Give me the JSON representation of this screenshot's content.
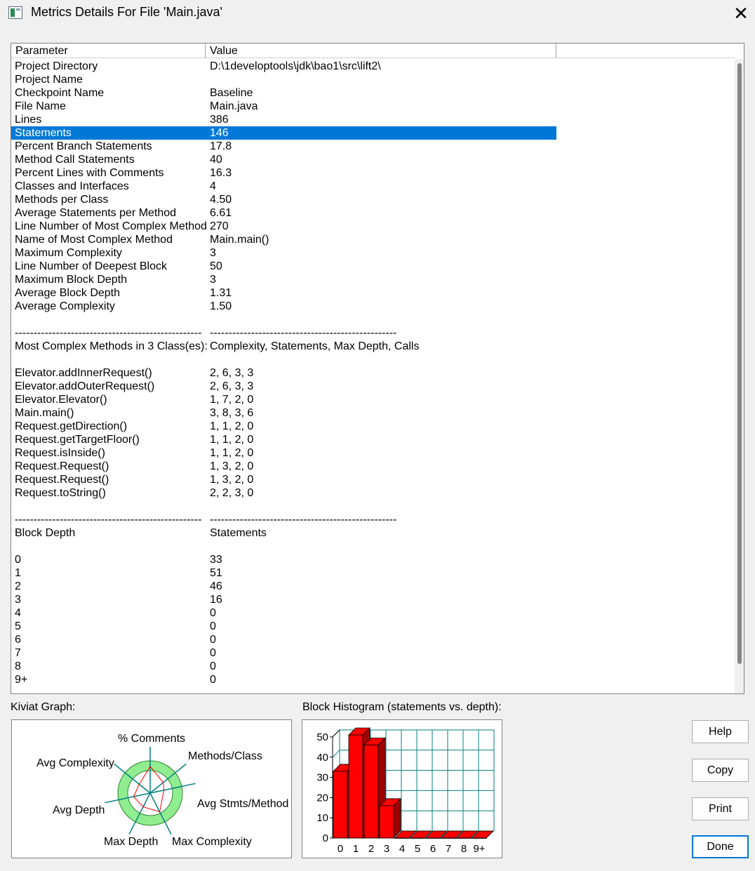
{
  "window": {
    "title": "Metrics Details For File 'Main.java'",
    "close_glyph": "✕"
  },
  "list": {
    "headers": {
      "parameter": "Parameter",
      "value": "Value"
    },
    "rows": [
      {
        "p": "Project Directory",
        "v": "D:\\1developtools\\jdk\\bao1\\src\\lift2\\"
      },
      {
        "p": "Project Name",
        "v": ""
      },
      {
        "p": "Checkpoint Name",
        "v": "Baseline"
      },
      {
        "p": "File Name",
        "v": "Main.java"
      },
      {
        "p": "Lines",
        "v": "386"
      },
      {
        "p": "Statements",
        "v": "146",
        "selected": true
      },
      {
        "p": "Percent Branch Statements",
        "v": "17.8"
      },
      {
        "p": "Method Call Statements",
        "v": "40"
      },
      {
        "p": "Percent Lines with Comments",
        "v": "16.3"
      },
      {
        "p": "Classes and Interfaces",
        "v": "4"
      },
      {
        "p": "Methods per Class",
        "v": "4.50"
      },
      {
        "p": "Average Statements per Method",
        "v": "6.61"
      },
      {
        "p": "Line Number of Most Complex Method",
        "v": "270"
      },
      {
        "p": "Name of Most Complex Method",
        "v": "Main.main()"
      },
      {
        "p": "Maximum Complexity",
        "v": "3"
      },
      {
        "p": "Line Number of Deepest Block",
        "v": "50"
      },
      {
        "p": "Maximum Block Depth",
        "v": "3"
      },
      {
        "p": "Average Block Depth",
        "v": "1.31"
      },
      {
        "p": "Average Complexity",
        "v": "1.50"
      },
      {
        "p": "",
        "v": ""
      },
      {
        "p": "--------------------------------------------------",
        "v": "--------------------------------------------------"
      },
      {
        "p": "Most Complex Methods in 3 Class(es):",
        "v": "Complexity, Statements, Max Depth, Calls"
      },
      {
        "p": "",
        "v": ""
      },
      {
        "p": "Elevator.addInnerRequest()",
        "v": "2, 6, 3, 3"
      },
      {
        "p": "Elevator.addOuterRequest()",
        "v": "2, 6, 3, 3"
      },
      {
        "p": "Elevator.Elevator()",
        "v": "1, 7, 2, 0"
      },
      {
        "p": "Main.main()",
        "v": "3, 8, 3, 6"
      },
      {
        "p": "Request.getDirection()",
        "v": "1, 1, 2, 0"
      },
      {
        "p": "Request.getTargetFloor()",
        "v": "1, 1, 2, 0"
      },
      {
        "p": "Request.isInside()",
        "v": "1, 1, 2, 0"
      },
      {
        "p": "Request.Request()",
        "v": "1, 3, 2, 0"
      },
      {
        "p": "Request.Request()",
        "v": "1, 3, 2, 0"
      },
      {
        "p": "Request.toString()",
        "v": "2, 2, 3, 0"
      },
      {
        "p": "",
        "v": ""
      },
      {
        "p": "--------------------------------------------------",
        "v": "--------------------------------------------------"
      },
      {
        "p": "Block Depth",
        "v": "Statements"
      },
      {
        "p": "",
        "v": ""
      },
      {
        "p": "0",
        "v": "33"
      },
      {
        "p": "1",
        "v": "51"
      },
      {
        "p": "2",
        "v": "46"
      },
      {
        "p": "3",
        "v": "16"
      },
      {
        "p": "4",
        "v": "0"
      },
      {
        "p": "5",
        "v": "0"
      },
      {
        "p": "6",
        "v": "0"
      },
      {
        "p": "7",
        "v": "0"
      },
      {
        "p": "8",
        "v": "0"
      },
      {
        "p": "9+",
        "v": "0"
      }
    ]
  },
  "kiviat": {
    "label": "Kiviat Graph:",
    "axes": [
      "% Comments",
      "Methods/Class",
      "Avg Stmts/Method",
      "Max Complexity",
      "Max Depth",
      "Avg Depth",
      "Avg Complexity"
    ],
    "colors": {
      "ring": "#90ee90",
      "inner": "#ffffff",
      "axis": "#008080",
      "value": "#ff0000"
    }
  },
  "histogram": {
    "label": "Block Histogram (statements vs. depth):",
    "y_ticks": [
      "50",
      "40",
      "30",
      "20",
      "10",
      "0"
    ],
    "colors": {
      "bar": "#ff0000",
      "grid": "#008080"
    }
  },
  "chart_data": {
    "type": "bar",
    "categories": [
      "0",
      "1",
      "2",
      "3",
      "4",
      "5",
      "6",
      "7",
      "8",
      "9+"
    ],
    "values": [
      33,
      51,
      46,
      16,
      0,
      0,
      0,
      0,
      0,
      0
    ],
    "title": "Block Histogram (statements vs. depth):",
    "xlabel": "",
    "ylabel": "",
    "ylim": [
      0,
      50
    ]
  },
  "buttons": {
    "help": "Help",
    "copy": "Copy",
    "print": "Print",
    "done": "Done"
  }
}
